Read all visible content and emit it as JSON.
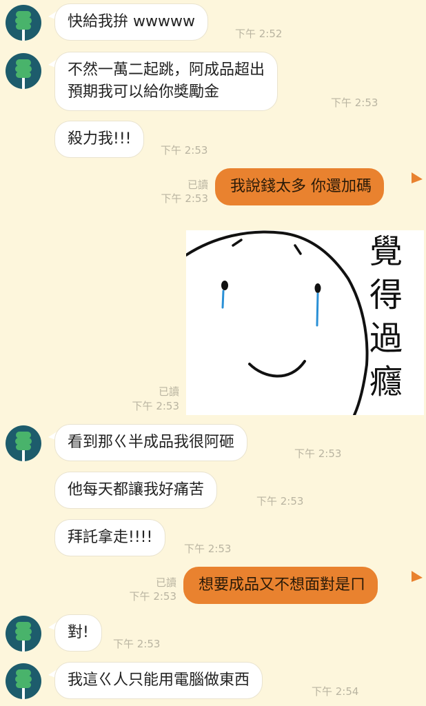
{
  "messages": [
    {
      "side": "in",
      "avatar": true,
      "text": "快給我拚 wwwww",
      "time": "下午 2:52"
    },
    {
      "side": "in",
      "avatar": true,
      "lines": [
        "不然一萬二起跳，阿成品超出",
        "預期我可以給你獎勵金"
      ],
      "time": "下午 2:53"
    },
    {
      "side": "in",
      "avatar": false,
      "text": "殺力我!!!",
      "time": "下午 2:53"
    },
    {
      "side": "out",
      "text": "我說錢太多 你還加碼",
      "read": "已讀",
      "time": "下午 2:53"
    },
    {
      "side": "out",
      "sticker": true,
      "sticker_text": "覺得過癮",
      "read": "已讀",
      "time": "下午 2:53"
    },
    {
      "side": "in",
      "avatar": true,
      "text": "看到那ㄍ半成品我很阿砸",
      "time": "下午 2:53"
    },
    {
      "side": "in",
      "avatar": false,
      "text": "他每天都讓我好痛苦",
      "time": "下午 2:53"
    },
    {
      "side": "in",
      "avatar": false,
      "text": "拜託拿走!!!!",
      "time": "下午 2:53"
    },
    {
      "side": "out",
      "text": "想要成品又不想面對是ㄇ",
      "read": "已讀",
      "time": "下午 2:53"
    },
    {
      "side": "in",
      "avatar": true,
      "text": "對!",
      "time": "下午 2:53"
    },
    {
      "side": "in",
      "avatar": true,
      "text": "我這ㄍ人只能用電腦做東西",
      "time": "下午 2:54"
    }
  ],
  "colors": {
    "background": "#fdf6dc",
    "outgoing": "#e9822f",
    "incoming": "#ffffff",
    "avatar": "#1d5c6c",
    "avatar_icon": "#49b36b"
  }
}
